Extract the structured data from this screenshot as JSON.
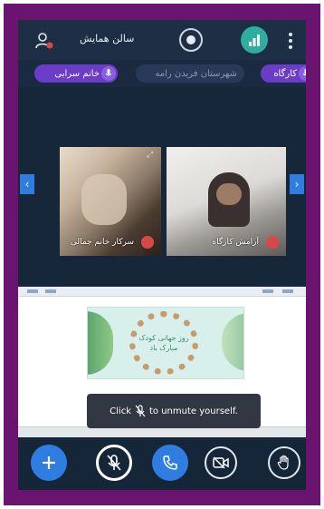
{
  "header": {
    "room_title": "سالن همایش",
    "icons": {
      "participants": "participants-icon",
      "record": "record-icon",
      "stats": "connection-stats-icon",
      "more": "more-vertical-icon"
    }
  },
  "talkers": [
    {
      "name": "خانم سرابی"
    },
    {
      "name": "شهرستان فریدن رامه"
    },
    {
      "name": "کارگاه"
    }
  ],
  "videos": [
    {
      "name": "سرکار خانم جمالی"
    },
    {
      "name": "آرامش کارگاه"
    }
  ],
  "shared_screen": {
    "slide_text": "روز جهانی کودک مبارک باد"
  },
  "toast": {
    "text_before": "Click",
    "text_after": "to unmute yourself."
  },
  "actions": [
    {
      "id": "plus",
      "icon": "plus-icon"
    },
    {
      "id": "mic",
      "icon": "microphone-muted-icon"
    },
    {
      "id": "hangup",
      "icon": "phone-icon"
    },
    {
      "id": "camera",
      "icon": "video-camera-icon"
    },
    {
      "id": "hand",
      "icon": "raise-hand-icon"
    }
  ],
  "colors": {
    "frame": "#6a1470",
    "app_background": "#152638",
    "accent": "#2f7de1",
    "talker_active": "#6b3cc7",
    "stats_green": "#2eae9e",
    "muted_red": "#d94848"
  }
}
